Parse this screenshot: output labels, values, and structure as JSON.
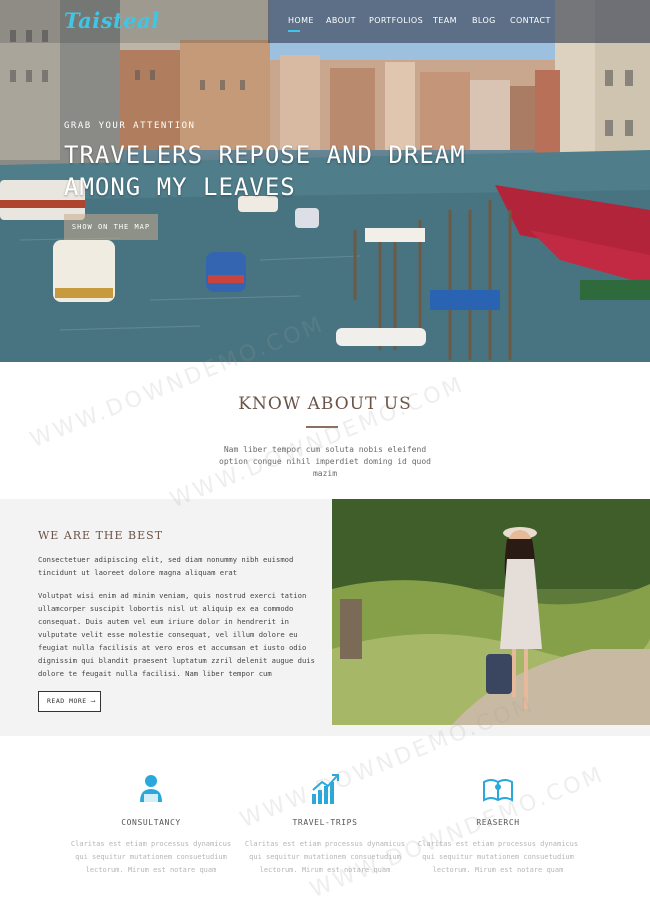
{
  "brand": {
    "logo": "Taisteal"
  },
  "nav": {
    "items": [
      {
        "label": "HOME"
      },
      {
        "label": "ABOUT"
      },
      {
        "label": "PORTFOLIOS"
      },
      {
        "label": "TEAM"
      },
      {
        "label": "BLOG"
      },
      {
        "label": "CONTACT"
      }
    ],
    "active": "HOME",
    "accent_color": "#3fc6e6"
  },
  "hero": {
    "kicker": "GRAB YOUR ATTENTION",
    "title_line1": "TRAVELERS REPOSE AND DREAM",
    "title_line2": "AMONG MY LEAVES",
    "button_label": "SHOW ON THE MAP"
  },
  "about": {
    "title": "KNOW ABOUT US",
    "text": "Nam liber tempor cum soluta nobis eleifend option congue nihil imperdiet doming id quod mazim"
  },
  "best": {
    "title": "WE ARE THE BEST",
    "paragraph1": "Consectetuer adipiscing elit, sed diam nonummy nibh euismod tincidunt ut laoreet dolore magna aliquam erat",
    "paragraph2": "Volutpat wisi enim ad minim veniam, quis nostrud exerci tation ullamcorper suscipit lobortis nisl ut aliquip ex ea commodo consequat. Duis autem vel eum iriure dolor in hendrerit in vulputate velit esse molestie consequat, vel illum dolore eu feugiat nulla facilisis at vero eros et accumsan et iusto odio dignissim qui blandit praesent luptatum zzril delenit augue duis dolore te feugait nulla facilisi. Nam liber tempor cum",
    "button_label": "READ MORE",
    "button_arrow": "⟶"
  },
  "services": [
    {
      "name": "CONSULTANCY",
      "icon": "consultant-person-icon",
      "desc": "Claritas est etiam processus dynamicus qui sequitur mutationem consuetudium lectorum. Mirum est notare quam"
    },
    {
      "name": "TRAVEL-TRIPS",
      "icon": "growth-chart-icon",
      "desc": "Claritas est etiam processus dynamicus qui sequitur mutationem consuetudium lectorum. Mirum est notare quam"
    },
    {
      "name": "REASERCH",
      "icon": "open-book-icon",
      "desc": "Claritas est etiam processus dynamicus qui sequitur mutationem consuetudium lectorum. Mirum est notare quam"
    }
  ],
  "watermark": "WWW.DOWNDEMO.COM",
  "colors": {
    "heading_brown": "#6b5448",
    "section_gray": "#f3f3f3",
    "icon_blue": "#2aa8dc"
  }
}
